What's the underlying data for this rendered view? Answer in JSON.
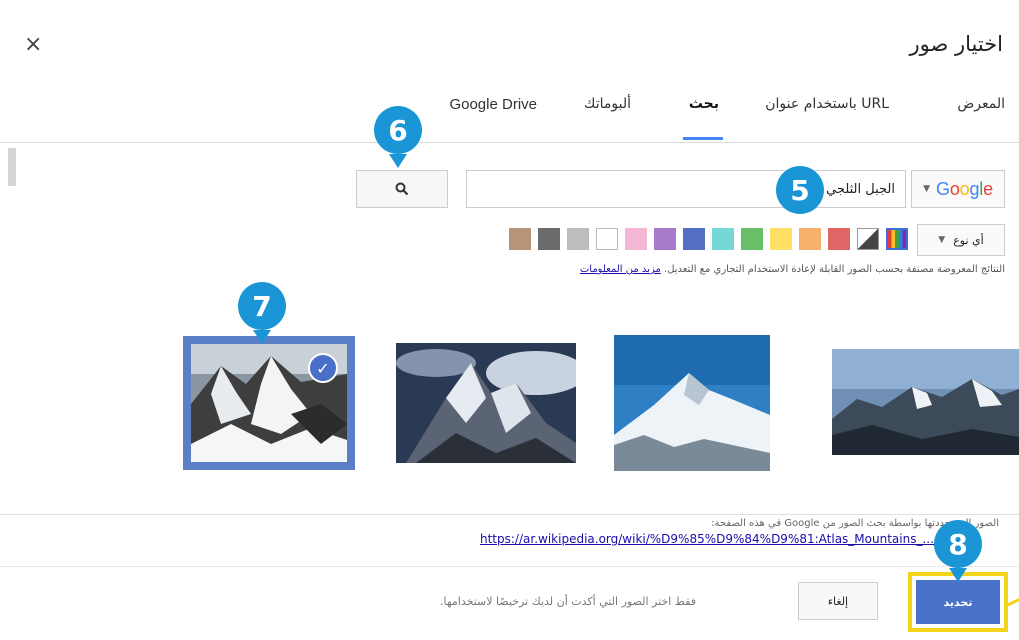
{
  "dialog": {
    "title": "اختيار صور",
    "close": "×"
  },
  "tabs": [
    {
      "label": "المعرض",
      "active": false
    },
    {
      "label": "باستخدام عنوان URL",
      "active": false
    },
    {
      "label": "بحث",
      "active": true
    },
    {
      "label": "ألبوماتك",
      "active": false
    },
    {
      "label": "Google Drive",
      "active": false
    }
  ],
  "search": {
    "engine": "Google",
    "query": "الجبل الثلجي",
    "type_filter": "أي نوع"
  },
  "color_swatches": [
    {
      "name": "full-color",
      "color": "multicolor"
    },
    {
      "name": "black-and-white",
      "color": "#444444"
    },
    {
      "name": "red",
      "color": "#e06666"
    },
    {
      "name": "orange",
      "color": "#f6b26b"
    },
    {
      "name": "yellow",
      "color": "#ffe066"
    },
    {
      "name": "green",
      "color": "#6abf69"
    },
    {
      "name": "teal",
      "color": "#76d7d7"
    },
    {
      "name": "blue",
      "color": "#5470c6"
    },
    {
      "name": "purple",
      "color": "#a77bca"
    },
    {
      "name": "pink",
      "color": "#f4b6d2"
    },
    {
      "name": "white",
      "color": "#ffffff"
    },
    {
      "name": "gray",
      "color": "#bdbdbd"
    },
    {
      "name": "black",
      "color": "#6b6b6b"
    },
    {
      "name": "brown",
      "color": "#b89478"
    }
  ],
  "license": {
    "text": "النتائج المعروضة مصنفة بحسب الصور القابلة لإعادة الاستخدام التجاري مع التعديل.",
    "link": "مزيد من المعلومات"
  },
  "results": [
    {
      "name": "snow-mountain-1",
      "selected": true
    },
    {
      "name": "snow-mountain-2",
      "selected": false
    },
    {
      "name": "snow-mountain-3",
      "selected": false
    },
    {
      "name": "snow-mountain-4",
      "selected": false
    }
  ],
  "source": {
    "note": "الصور التي حددتها بواسطة بحث الصور من Google في هذه الصفحة:",
    "url": "https://ar.wikipedia.org/wiki/%D9%85%D9%84%D9%81:Atlas_Mountains_..._ver.jp"
  },
  "footer": {
    "note": "فقط اختر الصور التي أكدت أن لديك ترخيصًا لاستخدامها.",
    "cancel": "إلغاء",
    "select": "تحديد"
  },
  "callouts": [
    "5",
    "6",
    "7",
    "8"
  ],
  "accent_colors": {
    "callout": "#1a96d6",
    "highlight": "#f3d41a",
    "primary": "#4a72c8"
  }
}
